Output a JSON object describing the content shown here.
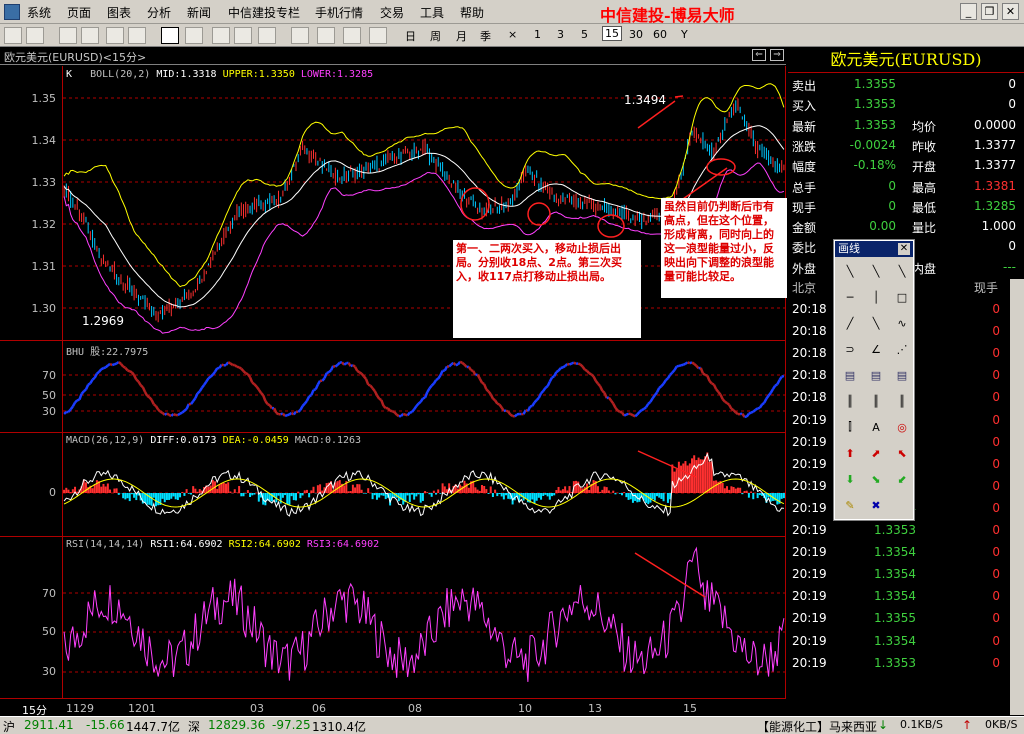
{
  "menu": {
    "items": [
      "系统",
      "页面",
      "图表",
      "分析",
      "新闻",
      "中信建投专栏",
      "手机行情",
      "交易",
      "工具",
      "帮助"
    ],
    "brand": "中信建投-博易大师"
  },
  "toolbar": {
    "periods": [
      "日",
      "周",
      "月",
      "季",
      "×",
      "1",
      "3",
      "5",
      "15",
      "30",
      "60",
      "Y"
    ],
    "active_period": "15"
  },
  "chart_title": "欧元美元(EURUSD)<15分>",
  "main": {
    "legend_k": "K",
    "legend_boll": "BOLL(20,2)",
    "mid": "MID:1.3318",
    "upper": "UPPER:1.3350",
    "lower": "LOWER:1.3285",
    "yticks": [
      "1.35",
      "1.34",
      "1.33",
      "1.32",
      "1.31",
      "1.30"
    ],
    "high_label": "1.3494",
    "low_label": "1.2969"
  },
  "bhu": {
    "title": "BHU 股:22.7975",
    "yticks": [
      "70",
      "50",
      "30"
    ]
  },
  "macd": {
    "title": "MACD(26,12,9)",
    "diff": "DIFF:0.0173",
    "dea": "DEA:-0.0459",
    "macd": "MACD:0.1263",
    "ytick": "0"
  },
  "rsi": {
    "title": "RSI(14,14,14)",
    "rsi1": "RSI1:64.6902",
    "rsi2": "RSI2:64.6902",
    "rsi3": "RSI3:64.6902",
    "yticks": [
      "70",
      "50",
      "30"
    ]
  },
  "xaxis": {
    "period": "15分",
    "ticks": [
      "1129",
      "1201",
      "03",
      "06",
      "08",
      "10",
      "13",
      "15"
    ]
  },
  "annotations": {
    "note1": "第一、二两次买入，移动止损后出局。分别收18点、2点。第三次买入，收117点打移动止损出局。",
    "note2": "虽然目前仍判断后市有高点，但在这个位置，形成背离，同时向上的这一浪型能量过小，反映出向下调整的浪型能量可能比较足。"
  },
  "panel": {
    "title": "欧元美元(EURUSD)",
    "rows": [
      {
        "k": "卖出",
        "v": "1.3355",
        "v2": "0"
      },
      {
        "k": "买入",
        "v": "1.3353",
        "v2": "0"
      },
      {
        "k": "最新",
        "v": "1.3353",
        "k2": "均价",
        "v3": "0.0000"
      },
      {
        "k": "涨跌",
        "v": "-0.0024",
        "k2": "昨收",
        "v3": "1.3377"
      },
      {
        "k": "幅度",
        "v": "-0.18%",
        "k2": "开盘",
        "v3": "1.3377"
      },
      {
        "k": "总手",
        "v": "0",
        "k2": "最高",
        "v3": "1.3381"
      },
      {
        "k": "现手",
        "v": "0",
        "k2": "最低",
        "v3": "1.3285"
      },
      {
        "k": "金额",
        "v": "0.00",
        "k2": "量比",
        "v3": "1.000"
      },
      {
        "k": "委比",
        "v2": "0"
      },
      {
        "k": "外盘",
        "k2": "内盘",
        "v3": "---"
      }
    ],
    "ticks_header": {
      "left": "北京",
      "right": "现手"
    },
    "ticks": [
      {
        "t": "20:18",
        "p": "",
        "q": "0"
      },
      {
        "t": "20:18",
        "p": "",
        "q": "0"
      },
      {
        "t": "20:18",
        "p": "",
        "q": "0"
      },
      {
        "t": "20:18",
        "p": "",
        "q": "0"
      },
      {
        "t": "20:18",
        "p": "",
        "q": "0"
      },
      {
        "t": "20:19",
        "p": "",
        "q": "0"
      },
      {
        "t": "20:19",
        "p": "",
        "q": "0"
      },
      {
        "t": "20:19",
        "p": "",
        "q": "0"
      },
      {
        "t": "20:19",
        "p": "",
        "q": "0"
      },
      {
        "t": "20:19",
        "p": "1.3354",
        "q": "0"
      },
      {
        "t": "20:19",
        "p": "1.3353",
        "q": "0"
      },
      {
        "t": "20:19",
        "p": "1.3354",
        "q": "0"
      },
      {
        "t": "20:19",
        "p": "1.3354",
        "q": "0"
      },
      {
        "t": "20:19",
        "p": "1.3354",
        "q": "0"
      },
      {
        "t": "20:19",
        "p": "1.3355",
        "q": "0"
      },
      {
        "t": "20:19",
        "p": "1.3354",
        "q": "0"
      },
      {
        "t": "20:19",
        "p": "1.3353",
        "q": "0"
      }
    ]
  },
  "draw_panel": {
    "title": "画线",
    "text_tool": "A"
  },
  "status": {
    "sh_label": "沪",
    "sh_index": "2911.41",
    "sh_change": "-15.66",
    "sh_amount": "1447.7亿",
    "sz_label": "深",
    "sz_index": "12829.36",
    "sz_change": "-97.25",
    "sz_amount": "1310.4亿",
    "ticker": "【能源化工】马来西亚",
    "net_down": "0.1KB/S",
    "net_up": "0KB/S"
  },
  "colors": {
    "bg": "#000000",
    "up": "#ff3030",
    "down": "#00c8ff",
    "boll_upper": "#ffff00",
    "boll_lower": "#ff40ff",
    "rsi": "#ff40ff",
    "bhu_up": "#1a3dff",
    "bhu_down": "#b02020"
  }
}
